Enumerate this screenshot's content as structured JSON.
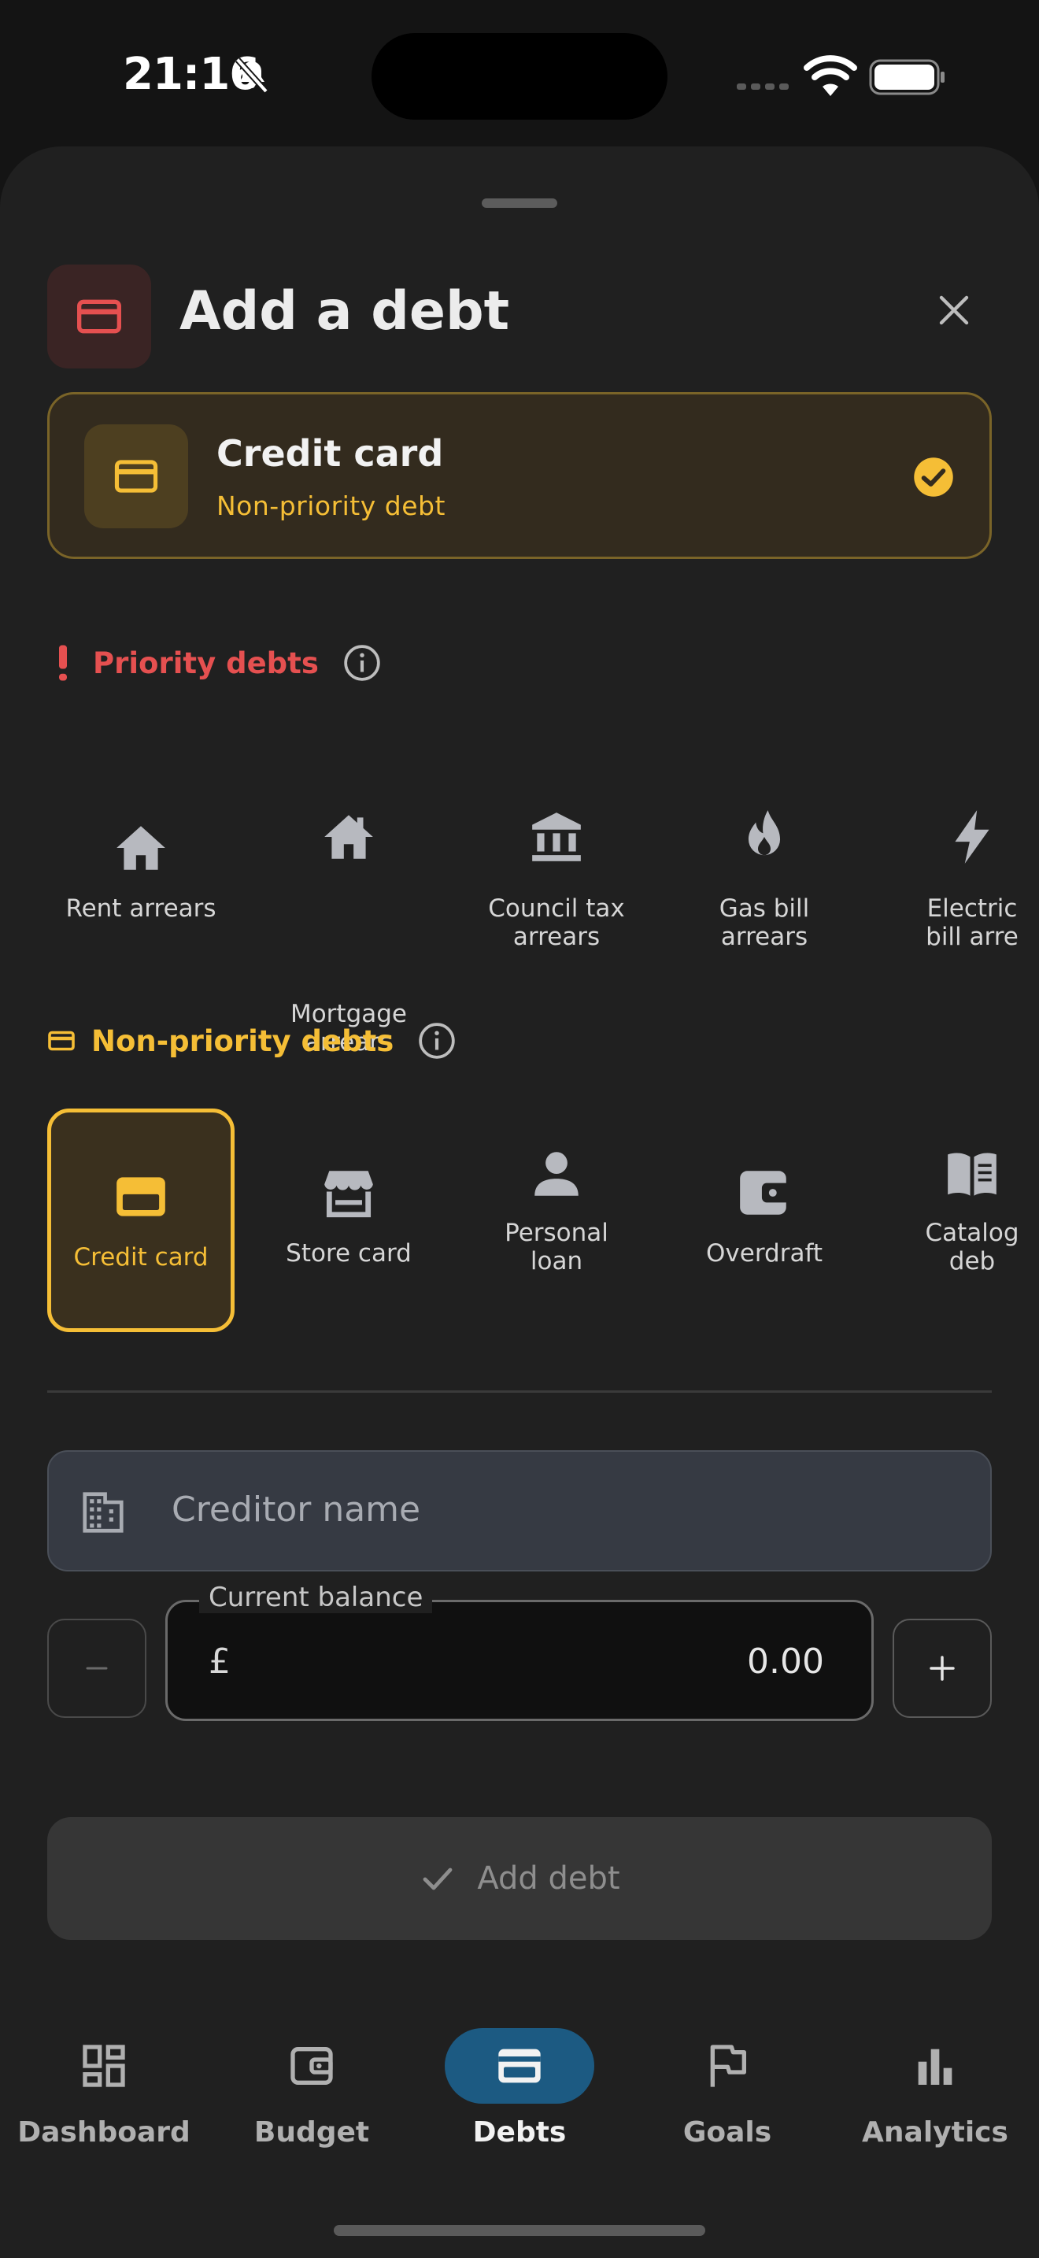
{
  "status_bar": {
    "time": "21:16"
  },
  "header": {
    "title": "Add a debt"
  },
  "selected": {
    "title": "Credit card",
    "subtitle": "Non-priority debt"
  },
  "priority": {
    "title": "Priority debts",
    "items": [
      {
        "label": "Rent arrears",
        "icon": "home-icon"
      },
      {
        "label": "Mortgage\narrears",
        "icon": "house-chimney-icon"
      },
      {
        "label": "Council tax\narrears",
        "icon": "bank-icon"
      },
      {
        "label": "Gas bill\narrears",
        "icon": "flame-icon"
      },
      {
        "label": "Electric\nbill arre",
        "icon": "bolt-icon"
      }
    ]
  },
  "non_priority": {
    "title": "Non-priority debts",
    "items": [
      {
        "label": "Credit card",
        "icon": "credit-card-icon"
      },
      {
        "label": "Store card",
        "icon": "store-icon"
      },
      {
        "label": "Personal\nloan",
        "icon": "person-icon"
      },
      {
        "label": "Overdraft",
        "icon": "wallet-icon"
      },
      {
        "label": "Catalog\ndeb",
        "icon": "book-icon"
      }
    ]
  },
  "form": {
    "creditor_placeholder": "Creditor name",
    "balance_label": "Current balance",
    "currency": "£",
    "balance_value": "0.00",
    "submit_label": "Add debt"
  },
  "nav": {
    "items": [
      {
        "label": "Dashboard",
        "icon": "dashboard-icon"
      },
      {
        "label": "Budget",
        "icon": "wallet-icon"
      },
      {
        "label": "Debts",
        "icon": "credit-card-icon"
      },
      {
        "label": "Goals",
        "icon": "flag-icon"
      },
      {
        "label": "Analytics",
        "icon": "bar-chart-icon"
      }
    ]
  },
  "colors": {
    "accent_yellow": "#F5BE36",
    "priority_red": "#E55050",
    "nav_active": "#1C5A82",
    "background": "#202020"
  }
}
